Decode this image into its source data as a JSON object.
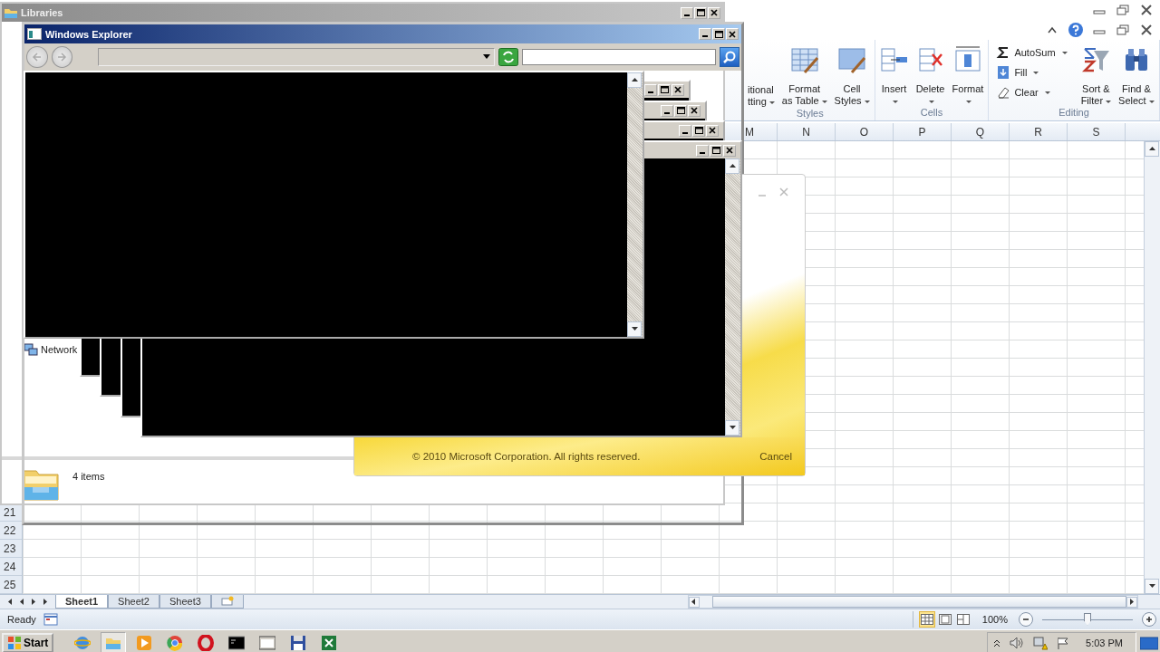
{
  "ribbon": {
    "groups": [
      {
        "label": "Styles",
        "buttons": [
          {
            "kind": "partial",
            "lines": [
              "itional",
              "tting"
            ],
            "dropdown": true
          },
          {
            "kind": "large",
            "lines": [
              "Format",
              "as Table"
            ],
            "dropdown": true
          },
          {
            "kind": "large",
            "lines": [
              "Cell",
              "Styles"
            ],
            "dropdown": true
          }
        ]
      },
      {
        "label": "Cells",
        "buttons": [
          {
            "kind": "large",
            "lines": [
              "Insert"
            ],
            "dropdown": true
          },
          {
            "kind": "large",
            "lines": [
              "Delete"
            ],
            "dropdown": true
          },
          {
            "kind": "large",
            "lines": [
              "Format"
            ],
            "dropdown": true
          }
        ]
      },
      {
        "label": "Editing",
        "buttons": [
          {
            "kind": "small",
            "lines": [
              "AutoSum"
            ],
            "dropdown": true
          },
          {
            "kind": "small",
            "lines": [
              "Fill"
            ],
            "dropdown": true
          },
          {
            "kind": "small",
            "lines": [
              "Clear"
            ],
            "dropdown": true
          },
          {
            "kind": "large",
            "lines": [
              "Sort &",
              "Filter"
            ],
            "dropdown": true
          },
          {
            "kind": "large",
            "lines": [
              "Find &",
              "Select"
            ],
            "dropdown": true
          }
        ]
      }
    ]
  },
  "columns": [
    "M",
    "N",
    "O",
    "P",
    "Q",
    "R",
    "S"
  ],
  "rows": [
    "21",
    "22",
    "23",
    "24",
    "25"
  ],
  "sheet_tabs": [
    {
      "label": "Sheet1",
      "selected": true
    },
    {
      "label": "Sheet2",
      "selected": false
    },
    {
      "label": "Sheet3",
      "selected": false
    }
  ],
  "status_bar": {
    "text": "Ready",
    "views": [
      {
        "selected": true
      },
      {
        "selected": false
      },
      {
        "selected": false
      }
    ],
    "zoom": "100%",
    "zoom_slider": {
      "level": 0.5
    }
  },
  "libraries": {
    "title": "Libraries",
    "nav_item": "Network",
    "status": "4 items"
  },
  "explorer": {
    "title": "Windows Explorer"
  },
  "splash": {
    "copyright": "© 2010 Microsoft Corporation.  All rights reserved.",
    "cancel": "Cancel"
  },
  "taskbar": {
    "start": "Start",
    "apps": [
      {
        "selected": false
      },
      {
        "selected": true
      },
      {
        "selected": false
      },
      {
        "selected": false
      },
      {
        "selected": false
      },
      {
        "selected": false
      },
      {
        "selected": false
      },
      {
        "selected": false
      },
      {
        "selected": false
      }
    ],
    "clock": "5:03 PM"
  }
}
